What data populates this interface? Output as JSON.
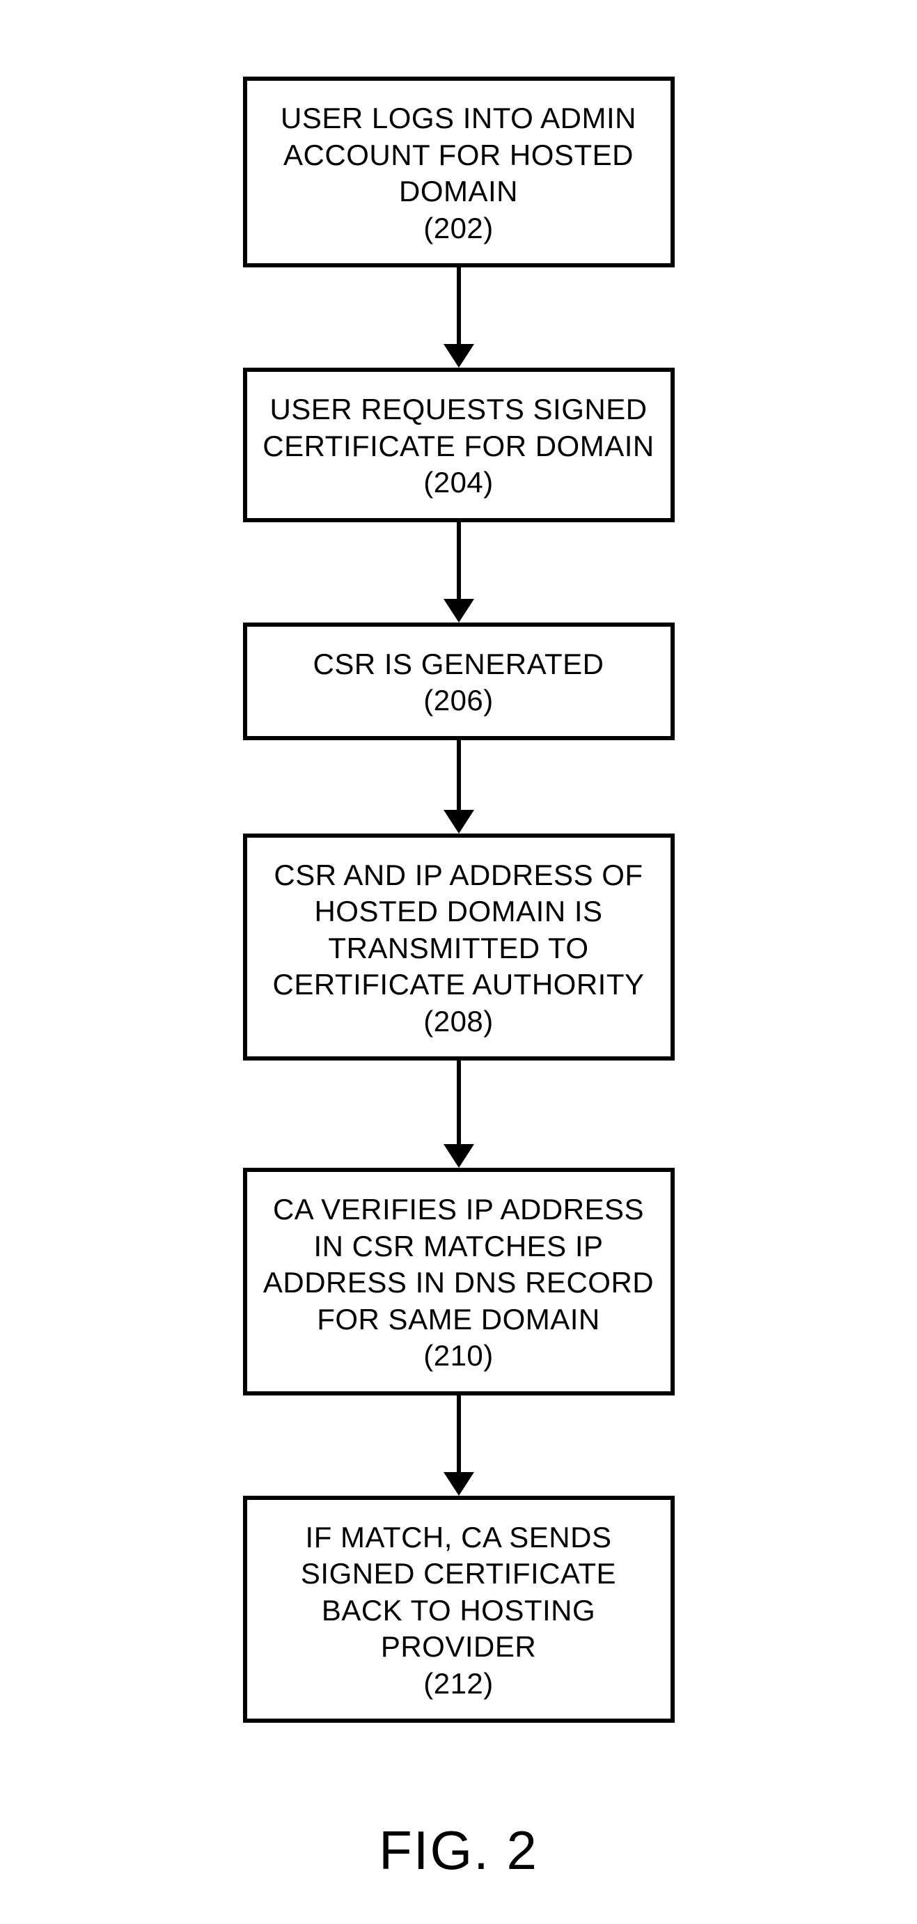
{
  "figure_label": "FIG. 2",
  "steps": [
    {
      "text": "USER LOGS INTO ADMIN ACCOUNT FOR HOSTED DOMAIN",
      "num": "(202)"
    },
    {
      "text": "USER REQUESTS SIGNED CERTIFICATE FOR DOMAIN",
      "num": "(204)"
    },
    {
      "text": "CSR IS GENERATED",
      "num": "(206)"
    },
    {
      "text": "CSR AND IP ADDRESS OF HOSTED DOMAIN IS TRANSMITTED TO CERTIFICATE AUTHORITY",
      "num": "(208)"
    },
    {
      "text": "CA VERIFIES IP ADDRESS IN CSR MATCHES IP ADDRESS IN DNS RECORD FOR SAME DOMAIN",
      "num": "(210)"
    },
    {
      "text": "IF MATCH, CA SENDS SIGNED CERTIFICATE BACK TO HOSTING PROVIDER",
      "num": "(212)"
    }
  ],
  "arrow_gaps": [
    110,
    110,
    100,
    120,
    110
  ]
}
